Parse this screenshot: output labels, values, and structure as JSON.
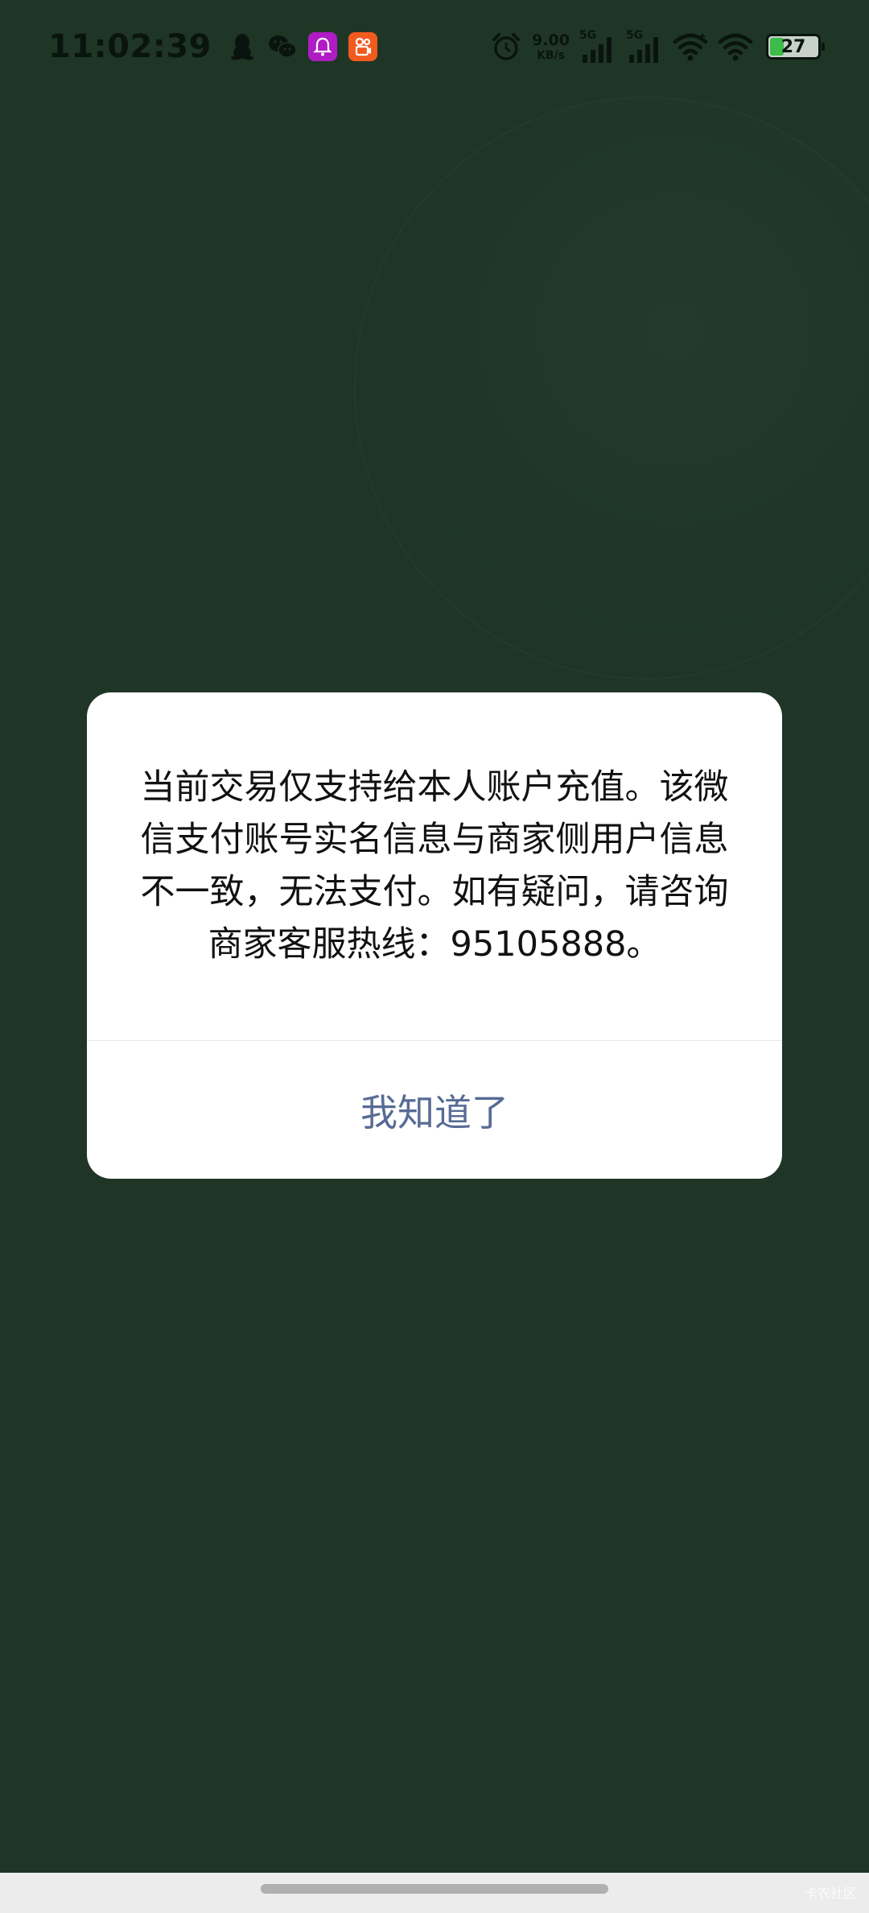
{
  "status_bar": {
    "time": "11:02:39",
    "net_speed_value": "9.00",
    "net_speed_unit": "KB/s",
    "signal_1_label": "5G",
    "signal_2_label": "5G",
    "battery_level": "27",
    "icons": [
      "qq-icon",
      "wechat-icon",
      "bell-app-icon",
      "kuaishou-icon",
      "alarm-icon",
      "wifi-icon",
      "wifi-icon"
    ]
  },
  "dialog": {
    "message": "当前交易仅支持给本人账户充值。该微信支付账号实名信息与商家侧用户信息不一致，无法支付。如有疑问，请咨询商家客服热线：95105888。",
    "button_label": "我知道了"
  },
  "watermark": "卡农社区",
  "colors": {
    "background": "#1f3627",
    "dialog_bg": "#ffffff",
    "button_text": "#576b95",
    "battery_fill": "#3dbb4b"
  }
}
